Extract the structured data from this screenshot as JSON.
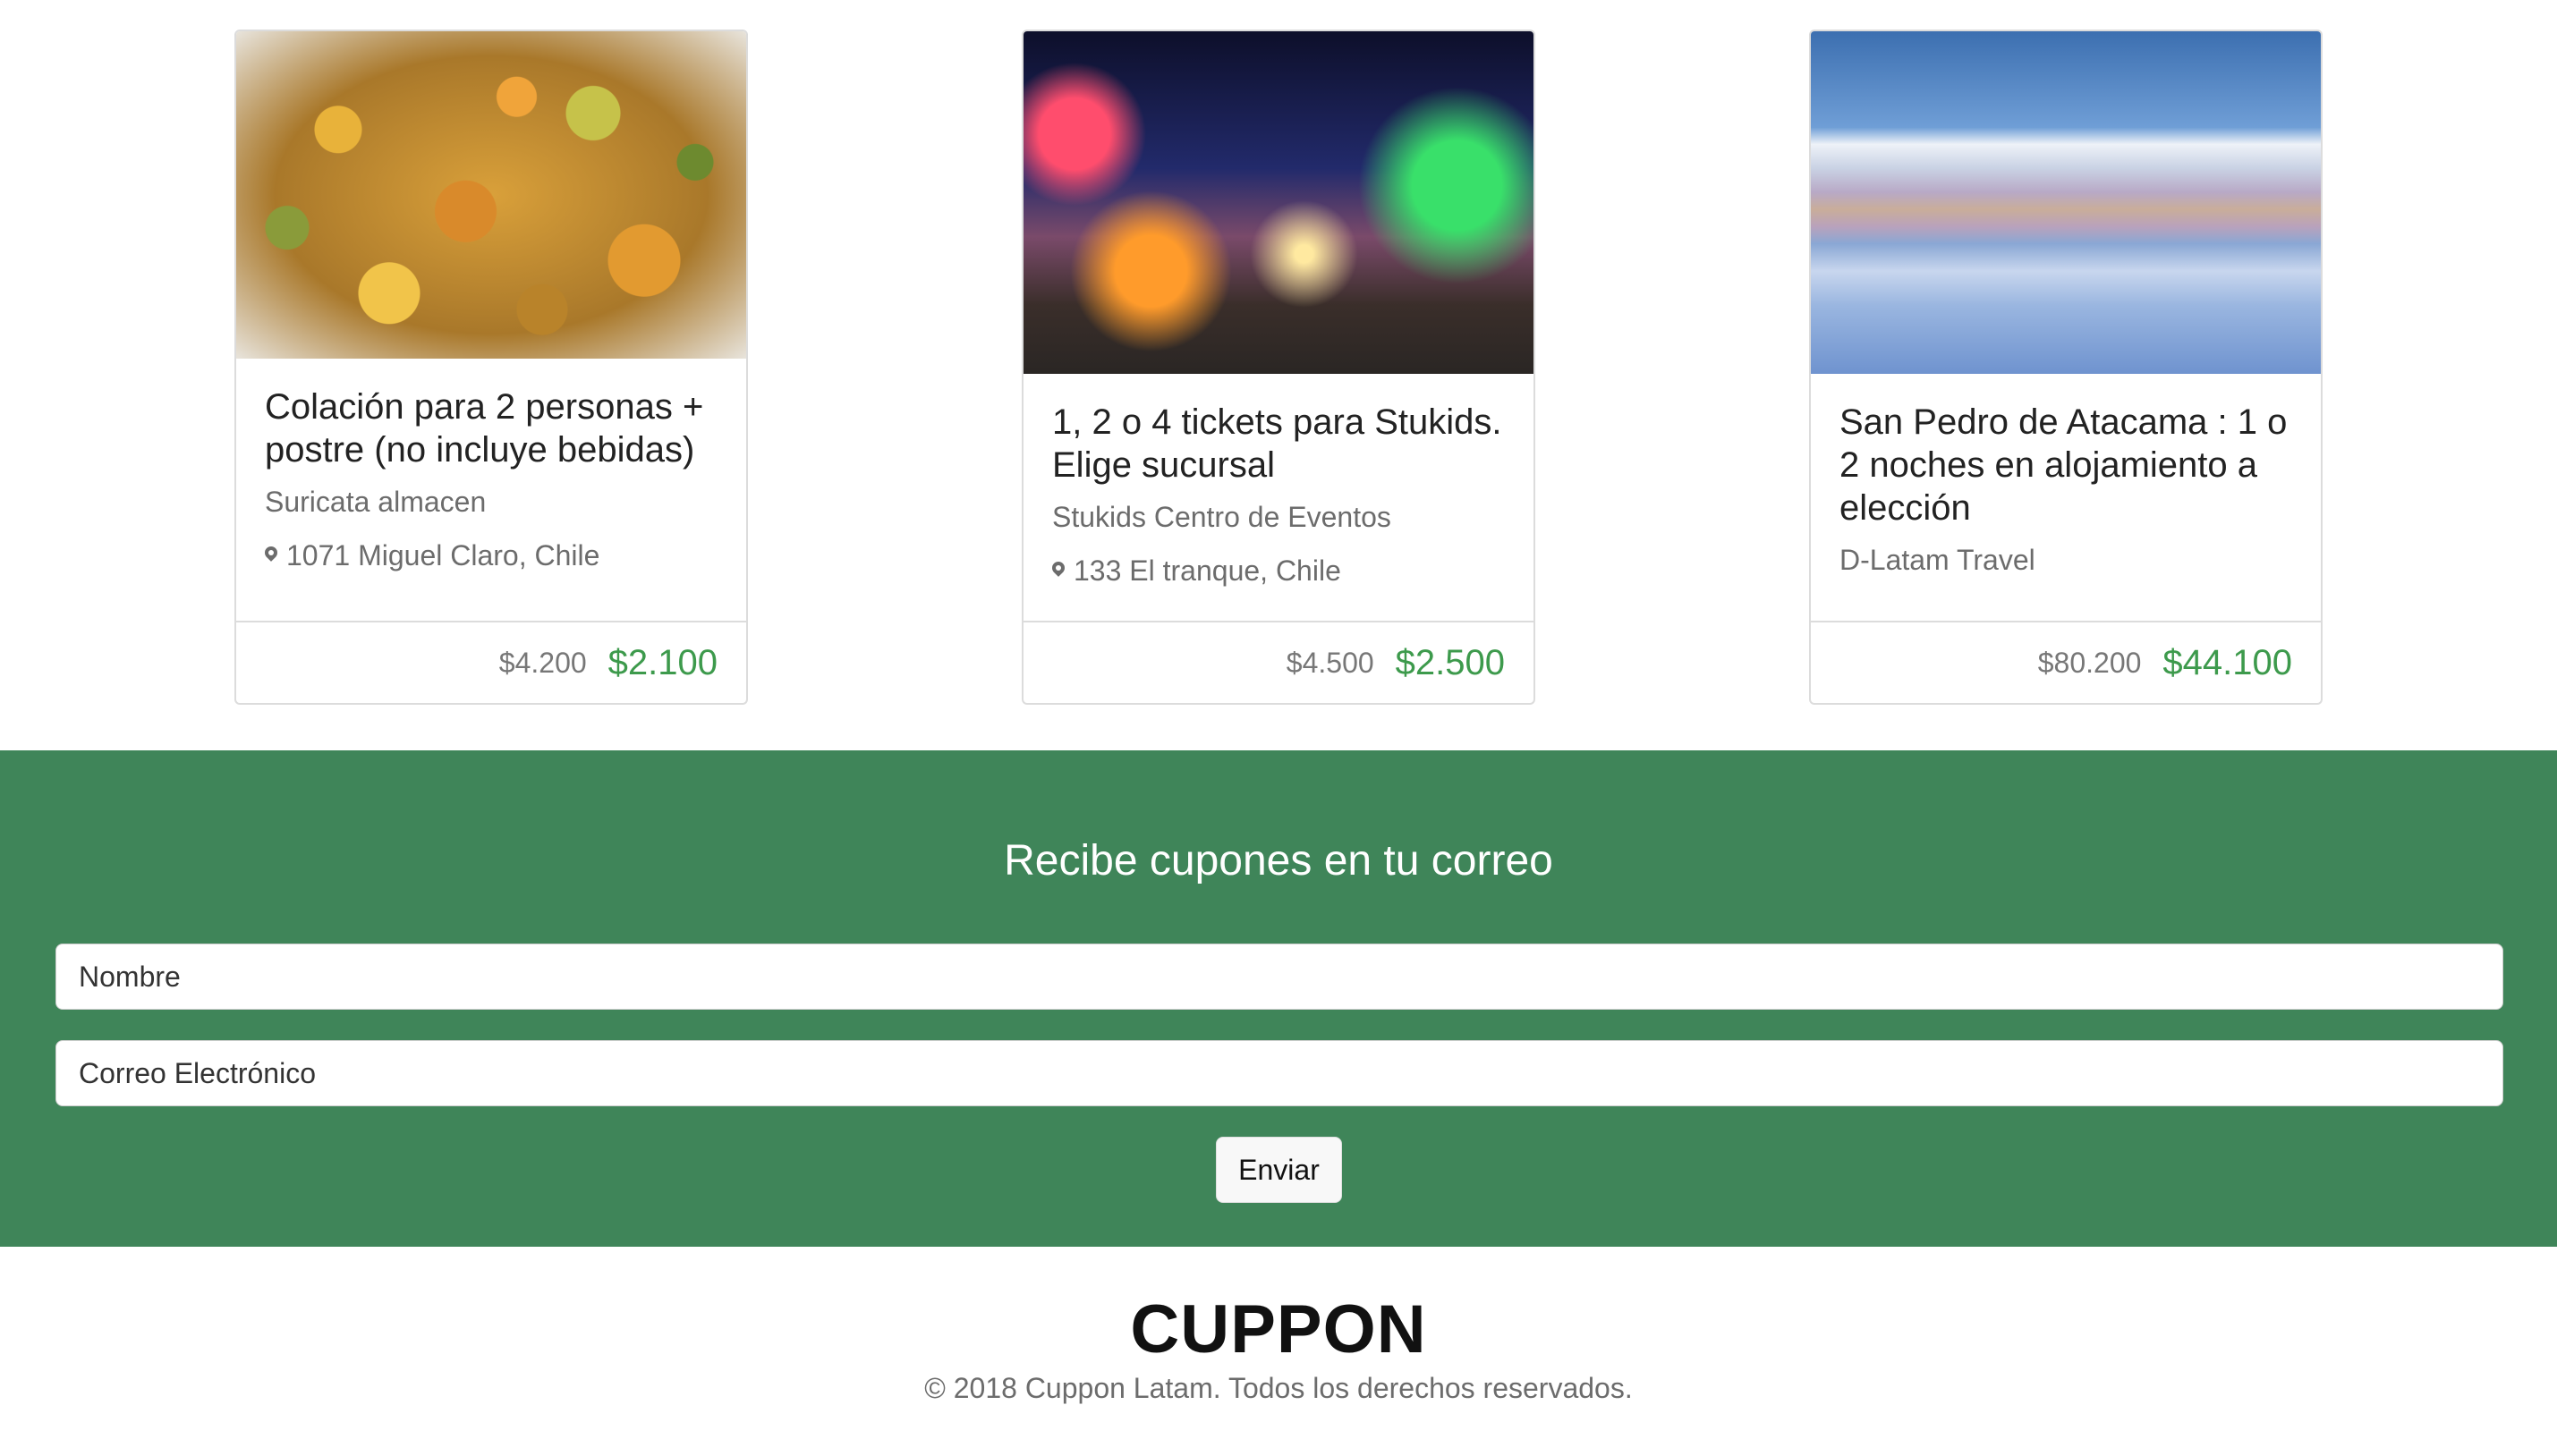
{
  "offers": [
    {
      "image_alt": "food",
      "title": "Colación para 2 personas + postre (no incluye bebidas)",
      "merchant": "Suricata almacen",
      "location": "1071 Miguel Claro, Chile",
      "old_price": "$4.200",
      "new_price": "$2.100"
    },
    {
      "image_alt": "fair",
      "title": "1, 2 o 4 tickets para Stukids. Elige sucursal",
      "merchant": "Stukids Centro de Eventos",
      "location": "133 El tranque, Chile",
      "old_price": "$4.500",
      "new_price": "$2.500"
    },
    {
      "image_alt": "desert",
      "title": "San Pedro de Atacama : 1 o 2 noches en alojamiento a elección",
      "merchant": "D-Latam Travel",
      "location": "",
      "old_price": "$80.200",
      "new_price": "$44.100"
    }
  ],
  "subscribe": {
    "title": "Recibe cupones en tu correo",
    "name_placeholder": "Nombre",
    "email_placeholder": "Correo Electrónico",
    "submit_label": "Enviar",
    "background_color": "#3f8559"
  },
  "footer": {
    "brand": "CUPPON",
    "copyright": "© 2018 Cuppon Latam. Todos los derechos reservados."
  },
  "colors": {
    "price_accent": "#3d9a4c",
    "muted_text": "#6c6c6c"
  }
}
